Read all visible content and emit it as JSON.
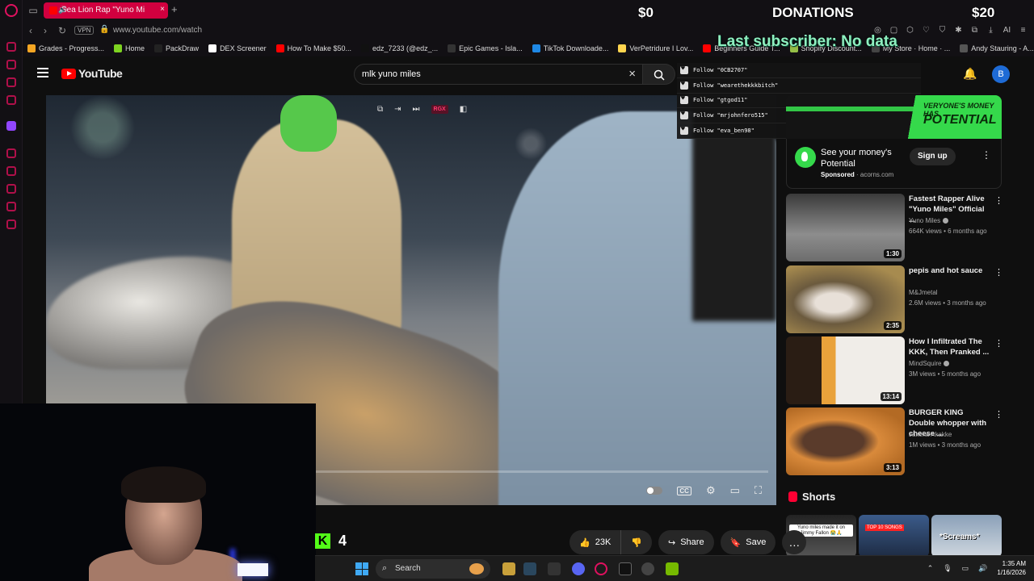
{
  "browser": {
    "tab": {
      "title": "Sea Lion Rap \"Yuno Mi"
    },
    "url": "www.youtube.com/watch",
    "vpn_label": "VPN",
    "bookmarks": [
      {
        "label": "Grades - Progress...",
        "color": "#f5a623"
      },
      {
        "label": "Home",
        "color": "#7ed321"
      },
      {
        "label": "PackDraw",
        "color": "#222222"
      },
      {
        "label": "DEX Screener",
        "color": "#ffffff"
      },
      {
        "label": "How To Make $50...",
        "color": "#ff0000"
      },
      {
        "label": "edz_7233 (@edz_...",
        "color": "#111111"
      },
      {
        "label": "Epic Games - Isla...",
        "color": "#333333"
      },
      {
        "label": "TikTok Downloade...",
        "color": "#1e88e5"
      },
      {
        "label": "VerPetridure I Lov...",
        "color": "#ffd54f"
      },
      {
        "label": "Beginners Guide T...",
        "color": "#ff0000"
      },
      {
        "label": "Shopify Discount...",
        "color": "#95bf47"
      },
      {
        "label": "My Store · Home · ...",
        "color": "#444444"
      },
      {
        "label": "Andy Stauring - A...",
        "color": "#555555"
      }
    ],
    "ai_label": "AI"
  },
  "overlay": {
    "money_left": "$0",
    "donations": "DONATIONS",
    "money_right": "$20",
    "last_subscriber": "Last subscriber: No data",
    "follows": [
      "Follow \"0CB2707\"",
      "Follow \"wearethekkkbitch\"",
      "Follow \"gtgod11\"",
      "Follow \"mrjohnfero515\"",
      "Follow \"eva_ben98\""
    ],
    "kick_count": "4"
  },
  "youtube": {
    "logo_text": "YouTube",
    "search_query": "mlk yuno miles",
    "avatar_letter": "B",
    "player": {
      "rgx_label": "RGX",
      "progress": 0
    },
    "actions": {
      "likes": "23K",
      "share": "Share",
      "save": "Save"
    },
    "ad": {
      "banner_small": "VERYONE'S MONEY HAS",
      "banner_big": "POTENTIAL",
      "title": "See your money's Potential",
      "sponsored": "Sponsored",
      "domain": "acorns.com",
      "cta": "Sign up"
    },
    "recommended": [
      {
        "title": "Fastest Rapper Alive \"Yuno Miles\" Official ...",
        "channel": "Yuno Miles",
        "verified": true,
        "meta": "664K views • 6 months ago",
        "duration": "1:30"
      },
      {
        "title": "pepis and hot sauce",
        "channel": "M&Jmetal",
        "verified": false,
        "meta": "2.6M views • 3 months ago",
        "duration": "2:35"
      },
      {
        "title": "How I Infiltrated The KKK, Then Pranked ...",
        "channel": "MindSquire",
        "verified": true,
        "meta": "3M views • 5 months ago",
        "duration": "13:14"
      },
      {
        "title": "BURGER KING Double whopper with cheese ...",
        "channel": "Jakeka Akakke",
        "verified": false,
        "meta": "1M views • 3 months ago",
        "duration": "3:13"
      }
    ],
    "shorts": {
      "heading": "Shorts",
      "items": [
        {
          "label": "Yuno miles made it on Jimmy Fallon 😭🙏"
        },
        {
          "label": "TOP 10 SONGS"
        },
        {
          "label": "*Screams*"
        }
      ]
    }
  },
  "taskbar": {
    "search_label": "Search",
    "time": "1:35 AM",
    "date": "1/16/2026"
  }
}
